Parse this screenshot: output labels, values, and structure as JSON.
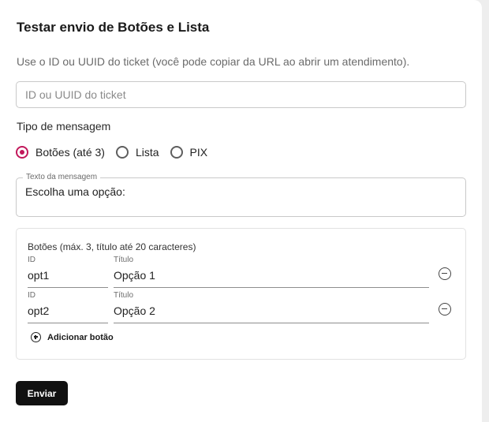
{
  "form": {
    "title": "Testar envio de Botões e Lista",
    "hint": "Use o ID ou UUID do ticket (você pode copiar da URL ao abrir um atendimento).",
    "ticket_placeholder": "ID ou UUID do ticket",
    "ticket_value": ""
  },
  "message_type": {
    "label": "Tipo de mensagem",
    "options": [
      {
        "label": "Botões (até 3)",
        "checked": true
      },
      {
        "label": "Lista",
        "checked": false
      },
      {
        "label": "PIX",
        "checked": false
      }
    ]
  },
  "message_text": {
    "legend": "Texto da mensagem",
    "value": "Escolha uma opção:"
  },
  "buttons_panel": {
    "title": "Botões (máx. 3, título até 20 caracteres)",
    "id_label": "ID",
    "title_label": "Título",
    "rows": [
      {
        "id": "opt1",
        "title": "Opção 1"
      },
      {
        "id": "opt2",
        "title": "Opção 2"
      }
    ],
    "add_label": "Adicionar botão",
    "remove_icon": "minus-circle-icon",
    "add_icon": "plus-circle-icon"
  },
  "actions": {
    "send_label": "Enviar"
  },
  "colors": {
    "accent": "#c2185b",
    "primary_button": "#111111"
  }
}
